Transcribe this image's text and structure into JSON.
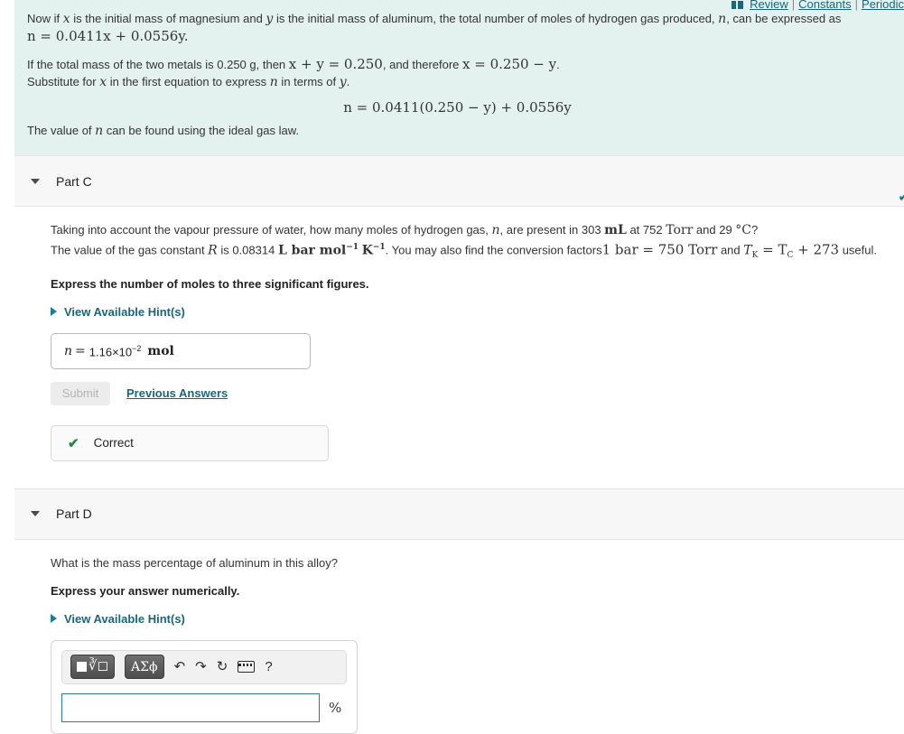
{
  "toplinks": {
    "grid_icon": "grid-icon",
    "review": "Review",
    "separator": "|",
    "constants": "Constants",
    "periodic": "Periodic"
  },
  "intro": {
    "para1_a": "Now if ",
    "para1_x": "x",
    "para1_b": " is the initial mass of magnesium and ",
    "para1_y": "y",
    "para1_c": " is the initial mass of aluminum, the total number of moles of hydrogen gas produced, ",
    "para1_n": "n",
    "para1_d": ", can be expressed as",
    "eq1": "n = 0.0411x + 0.0556y.",
    "para2_a": "If the total mass of the two metals is 0.250 g, then ",
    "para2_eq1": "x + y = 0.250",
    "para2_b": ", and therefore ",
    "para2_eq2": "x = 0.250 − y",
    "para2_c": ".",
    "para3_a": "Substitute for ",
    "para3_x": "x",
    "para3_b": " in the first equation to express ",
    "para3_n": "n",
    "para3_c": " in terms of ",
    "para3_y": "y",
    "para3_d": ".",
    "centered_eq": "n = 0.0411(0.250 − y) + 0.0556y",
    "para4_a": "The value of ",
    "para4_n": "n",
    "para4_b": " can be found using the ideal gas law."
  },
  "part_c": {
    "title": "Part C",
    "caret": "caret-down-icon",
    "status_check": "✔",
    "question_a": "Taking into account the vapour pressure of water, how many moles of hydrogen gas, ",
    "question_n": "n",
    "question_b": ", are present in 303 ",
    "question_ml": "mL",
    "question_c": " at 752 ",
    "question_torr": "Torr",
    "question_d": " and 29 ",
    "question_degc": "°C",
    "question_e": "?",
    "line2_a": "The value of the gas constant ",
    "line2_R": "R",
    "line2_b": " is 0.08314 ",
    "line2_units": "L bar mol",
    "line2_sup1": "−1",
    "line2_K": "K",
    "line2_sup2": "−1",
    "line2_c": ". You may also find the conversion factors",
    "line2_conv1": "1 bar = 750 Torr",
    "line2_and": " and ",
    "line2_conv2": "T",
    "line2_conv2_sub": "K",
    "line2_conv2_rest": " = T",
    "line2_conv2_sub2": "C",
    "line2_conv2_tail": " + 273",
    "line2_d": " useful.",
    "instruction": "Express the number of moles to three significant figures.",
    "hints_label": "View Available Hint(s)",
    "answer_var": "n",
    "answer_eq": "=",
    "answer_value": "1.16×10",
    "answer_exponent": "−2",
    "answer_unit": "mol",
    "submit_label": "Submit",
    "previous_answers_label": "Previous Answers",
    "feedback_icon": "check-icon",
    "feedback_label": "Correct"
  },
  "part_d": {
    "title": "Part D",
    "caret": "caret-down-icon",
    "question": "What is the mass percentage of aluminum in this alloy?",
    "instruction": "Express your answer numerically.",
    "hints_label": "View Available Hint(s)",
    "toolbar": {
      "template_button": "√",
      "greek_button": "ΑΣϕ",
      "undo_icon": "↶",
      "redo_icon": "↷",
      "reset_icon": "↻",
      "keyboard_icon": "keyboard-icon",
      "help_icon": "?"
    },
    "input_value": "",
    "input_placeholder": "",
    "unit_suffix": "%"
  },
  "colors": {
    "intro_bg": "#e4f2ef",
    "header_bg": "#f7f7f7",
    "link": "#15687f",
    "correct_green": "#1e8a3c",
    "input_border": "#2b7a99"
  }
}
